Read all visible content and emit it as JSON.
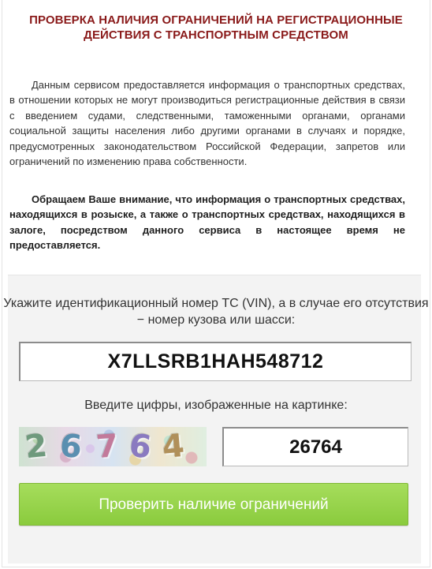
{
  "header": {
    "title": "ПРОВЕРКА НАЛИЧИЯ ОГРАНИЧЕНИЙ НА РЕГИСТРАЦИОННЫЕ ДЕЙСТВИЯ С ТРАНСПОРТНЫМ СРЕДСТВОМ"
  },
  "info": {
    "paragraph1": "Данным сервисом предоставляется информация о транспортных средствах, в отношении которых не могут производиться регистрационные действия в связи с введением судами, следственными, таможенными органами, органами социальной защиты населения либо другими органами в случаях и порядке, предусмотренных законодательством Российской Федерации, запретов или ограничений по изменению права собственности.",
    "paragraph2": "Обращаем Ваше внимание, что информация о транспортных средствах, находящихся в розыске, а также о транспортных средствах, находящихся в залоге, посредством данного сервиса в настоящее время не предоставляется."
  },
  "form": {
    "vin_label": "Укажите идентификационный номер ТС (VIN), а в случае его отсутствия − номер кузова или шасси:",
    "vin_value": "X7LLSRB1HAH548712",
    "captcha_label": "Введите цифры, изображенные на картинке:",
    "captcha_image_digits": [
      "2",
      "6",
      "7",
      "6",
      "4"
    ],
    "captcha_value": "26764",
    "submit_label": "Проверить наличие ограничений"
  },
  "colors": {
    "title": "#8a1a1a",
    "button": "#98d44b",
    "panel": "#f3f3f3"
  }
}
